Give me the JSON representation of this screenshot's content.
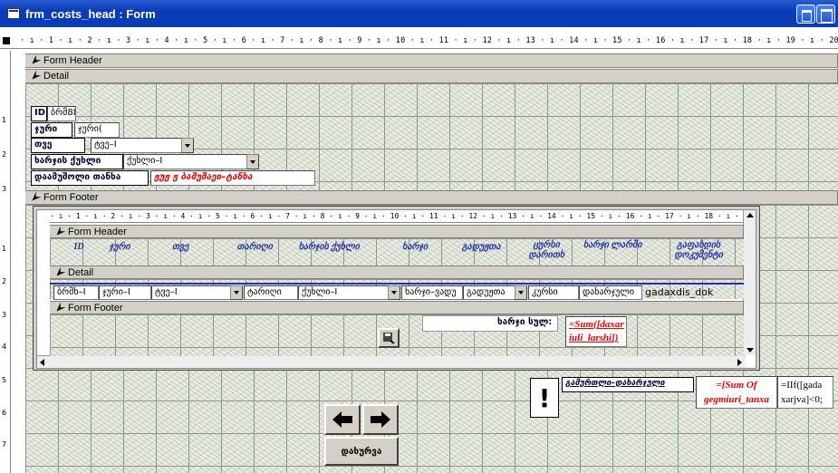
{
  "window": {
    "title": "frm_costs_head : Form"
  },
  "ruler": {
    "top": "· ı · 1 · ı · 2 · ı · 3 · ı · 4 · ı · 5 · ı · 6 · ı · 7 · ı · 8 · ı · 9 · ı · 10 · ı · 11 · ı · 12 · ı · 13 · ı · 14 · ı · 15 · ı · 16 · ı · 17 · ı · 18 · ı · 19 · ı · 20 · ı · 21 · ı · 22 · ı · 23 · ı · 24",
    "sub": "· ı · 1 · ı · 2 · ı · 3 · ı · 4 · ı · 5 · ı · 6 · ı · 7 · ı · 8 · ı · 9 · ı · 10 · ı · 11 · ı · 12 · ı · 13 · ı · 14 · ı · 15 · ı · 16 · ı · 17 · ı · 18 · ı · 19 · ı · 20 ·",
    "left": [
      "1",
      "2",
      "3",
      "1",
      "2",
      "3",
      "4",
      "5",
      "6",
      "7"
    ],
    "sub_left": [
      "1"
    ]
  },
  "sections": {
    "form_header": "Form Header",
    "detail": "Detail",
    "form_footer": "Form Footer"
  },
  "main_fields": {
    "id_label": "ID",
    "id_value": "ბრმ8I",
    "type_label": "ჯური",
    "type_value": "ჯური(",
    "month_label": "თვე",
    "month_value": "ტვე–I",
    "expense_label": "ხარჯის ქუხლი",
    "expense_value": "ქუხლი–I",
    "doc_label": "დაამუშოლი თანხა",
    "doc_value": "ჟუჟ  ჟ ბამუშაეი–ტანხა"
  },
  "subform": {
    "headers": [
      "ID",
      "ჯური",
      "თვე",
      "თარიღი",
      "ხარჯის ქუხლი",
      "ხარჯი",
      "გადუჟთა",
      "ცურსი დარითხ",
      "ხარჯი ლარში",
      "გაფახდის დოკუმენტი"
    ],
    "detail": [
      "ბრმხ–I",
      "ჯური–I",
      "ტვე–I",
      "ტარიღი",
      "ქუხლი–I",
      "ხარჯი–ვადუ",
      "გადუჟთა",
      "კურსი",
      "დახარჯული",
      "gadaxdis_dok"
    ],
    "footer_label": "ხარჯი სულ:",
    "footer_value": "=Sum([daxar iuli_larshi])"
  },
  "footer": {
    "total_label": "გამურთლი–დახარჯული",
    "total_value": "=[Sum Of gegmiuri_tanxa",
    "iif_value": "=IIf([gada xarjva]<0;",
    "warning_icon": "!",
    "nav_prev": "arrow-left-icon",
    "nav_next": "arrow-right-icon",
    "close_label": "დახურვა"
  }
}
